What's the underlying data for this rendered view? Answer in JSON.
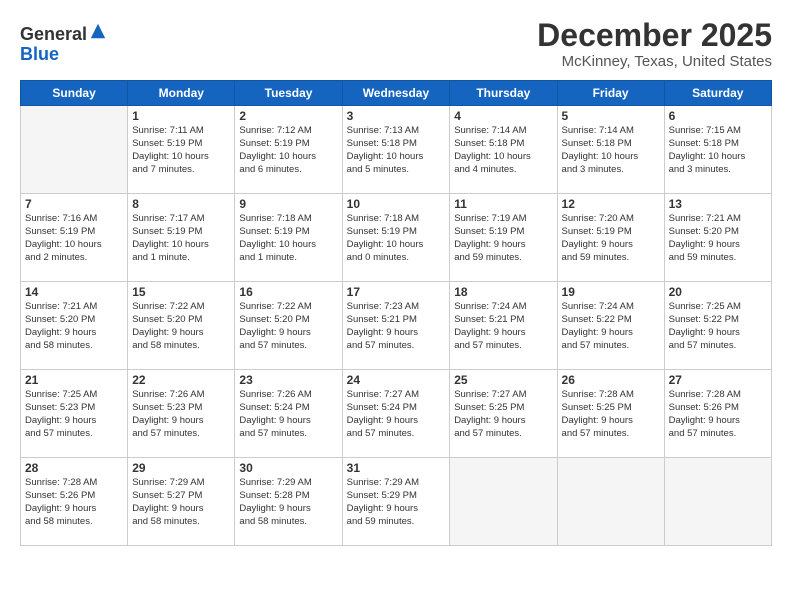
{
  "logo": {
    "general": "General",
    "blue": "Blue"
  },
  "title": "December 2025",
  "location": "McKinney, Texas, United States",
  "days_header": [
    "Sunday",
    "Monday",
    "Tuesday",
    "Wednesday",
    "Thursday",
    "Friday",
    "Saturday"
  ],
  "weeks": [
    [
      {
        "day": "",
        "info": ""
      },
      {
        "day": "1",
        "info": "Sunrise: 7:11 AM\nSunset: 5:19 PM\nDaylight: 10 hours\nand 7 minutes."
      },
      {
        "day": "2",
        "info": "Sunrise: 7:12 AM\nSunset: 5:19 PM\nDaylight: 10 hours\nand 6 minutes."
      },
      {
        "day": "3",
        "info": "Sunrise: 7:13 AM\nSunset: 5:18 PM\nDaylight: 10 hours\nand 5 minutes."
      },
      {
        "day": "4",
        "info": "Sunrise: 7:14 AM\nSunset: 5:18 PM\nDaylight: 10 hours\nand 4 minutes."
      },
      {
        "day": "5",
        "info": "Sunrise: 7:14 AM\nSunset: 5:18 PM\nDaylight: 10 hours\nand 3 minutes."
      },
      {
        "day": "6",
        "info": "Sunrise: 7:15 AM\nSunset: 5:18 PM\nDaylight: 10 hours\nand 3 minutes."
      }
    ],
    [
      {
        "day": "7",
        "info": "Sunrise: 7:16 AM\nSunset: 5:19 PM\nDaylight: 10 hours\nand 2 minutes."
      },
      {
        "day": "8",
        "info": "Sunrise: 7:17 AM\nSunset: 5:19 PM\nDaylight: 10 hours\nand 1 minute."
      },
      {
        "day": "9",
        "info": "Sunrise: 7:18 AM\nSunset: 5:19 PM\nDaylight: 10 hours\nand 1 minute."
      },
      {
        "day": "10",
        "info": "Sunrise: 7:18 AM\nSunset: 5:19 PM\nDaylight: 10 hours\nand 0 minutes."
      },
      {
        "day": "11",
        "info": "Sunrise: 7:19 AM\nSunset: 5:19 PM\nDaylight: 9 hours\nand 59 minutes."
      },
      {
        "day": "12",
        "info": "Sunrise: 7:20 AM\nSunset: 5:19 PM\nDaylight: 9 hours\nand 59 minutes."
      },
      {
        "day": "13",
        "info": "Sunrise: 7:21 AM\nSunset: 5:20 PM\nDaylight: 9 hours\nand 59 minutes."
      }
    ],
    [
      {
        "day": "14",
        "info": "Sunrise: 7:21 AM\nSunset: 5:20 PM\nDaylight: 9 hours\nand 58 minutes."
      },
      {
        "day": "15",
        "info": "Sunrise: 7:22 AM\nSunset: 5:20 PM\nDaylight: 9 hours\nand 58 minutes."
      },
      {
        "day": "16",
        "info": "Sunrise: 7:22 AM\nSunset: 5:20 PM\nDaylight: 9 hours\nand 57 minutes."
      },
      {
        "day": "17",
        "info": "Sunrise: 7:23 AM\nSunset: 5:21 PM\nDaylight: 9 hours\nand 57 minutes."
      },
      {
        "day": "18",
        "info": "Sunrise: 7:24 AM\nSunset: 5:21 PM\nDaylight: 9 hours\nand 57 minutes."
      },
      {
        "day": "19",
        "info": "Sunrise: 7:24 AM\nSunset: 5:22 PM\nDaylight: 9 hours\nand 57 minutes."
      },
      {
        "day": "20",
        "info": "Sunrise: 7:25 AM\nSunset: 5:22 PM\nDaylight: 9 hours\nand 57 minutes."
      }
    ],
    [
      {
        "day": "21",
        "info": "Sunrise: 7:25 AM\nSunset: 5:23 PM\nDaylight: 9 hours\nand 57 minutes."
      },
      {
        "day": "22",
        "info": "Sunrise: 7:26 AM\nSunset: 5:23 PM\nDaylight: 9 hours\nand 57 minutes."
      },
      {
        "day": "23",
        "info": "Sunrise: 7:26 AM\nSunset: 5:24 PM\nDaylight: 9 hours\nand 57 minutes."
      },
      {
        "day": "24",
        "info": "Sunrise: 7:27 AM\nSunset: 5:24 PM\nDaylight: 9 hours\nand 57 minutes."
      },
      {
        "day": "25",
        "info": "Sunrise: 7:27 AM\nSunset: 5:25 PM\nDaylight: 9 hours\nand 57 minutes."
      },
      {
        "day": "26",
        "info": "Sunrise: 7:28 AM\nSunset: 5:25 PM\nDaylight: 9 hours\nand 57 minutes."
      },
      {
        "day": "27",
        "info": "Sunrise: 7:28 AM\nSunset: 5:26 PM\nDaylight: 9 hours\nand 57 minutes."
      }
    ],
    [
      {
        "day": "28",
        "info": "Sunrise: 7:28 AM\nSunset: 5:26 PM\nDaylight: 9 hours\nand 58 minutes."
      },
      {
        "day": "29",
        "info": "Sunrise: 7:29 AM\nSunset: 5:27 PM\nDaylight: 9 hours\nand 58 minutes."
      },
      {
        "day": "30",
        "info": "Sunrise: 7:29 AM\nSunset: 5:28 PM\nDaylight: 9 hours\nand 58 minutes."
      },
      {
        "day": "31",
        "info": "Sunrise: 7:29 AM\nSunset: 5:29 PM\nDaylight: 9 hours\nand 59 minutes."
      },
      {
        "day": "",
        "info": ""
      },
      {
        "day": "",
        "info": ""
      },
      {
        "day": "",
        "info": ""
      }
    ]
  ]
}
